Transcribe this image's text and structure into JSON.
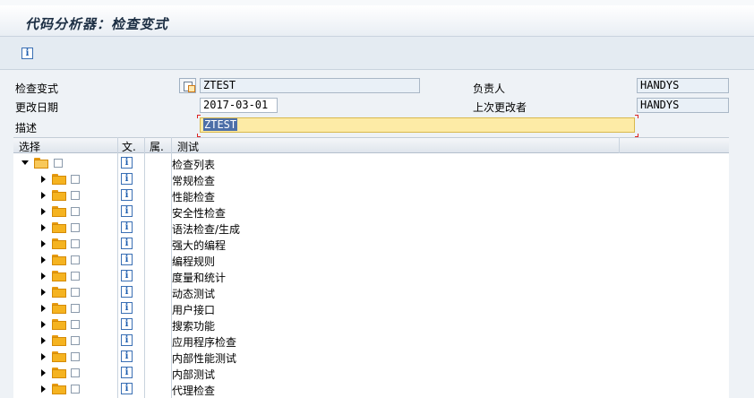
{
  "title": "代码分析器：检查变式",
  "toolbar": {
    "info_icon": "info-icon"
  },
  "form": {
    "variant_label": "检查变式",
    "variant_value": "ZTEST",
    "owner_label": "负责人",
    "owner_value": "HANDYS",
    "changed_on_label": "更改日期",
    "changed_on_value": "2017-03-01",
    "last_changed_by_label": "上次更改者",
    "last_changed_by_value": "HANDYS",
    "description_label": "描述",
    "description_value": "ZTEST"
  },
  "tree": {
    "headers": [
      "选择",
      "文.",
      "属.",
      "测试"
    ],
    "root": {
      "label": "检查列表",
      "icon": "info-icon"
    },
    "items": [
      "常规检查",
      "性能检查",
      "安全性检查",
      "语法检查/生成",
      "强大的编程",
      "编程规则",
      "度量和统计",
      "动态测试",
      "用户接口",
      "搜索功能",
      "应用程序检查",
      "内部性能测试",
      "内部测试",
      "代理检查"
    ]
  },
  "colors": {
    "background": "#eef2f6",
    "folder": "#f5b320",
    "description_highlight": "#fdeba6",
    "info_blue": "#1f5fb0"
  }
}
